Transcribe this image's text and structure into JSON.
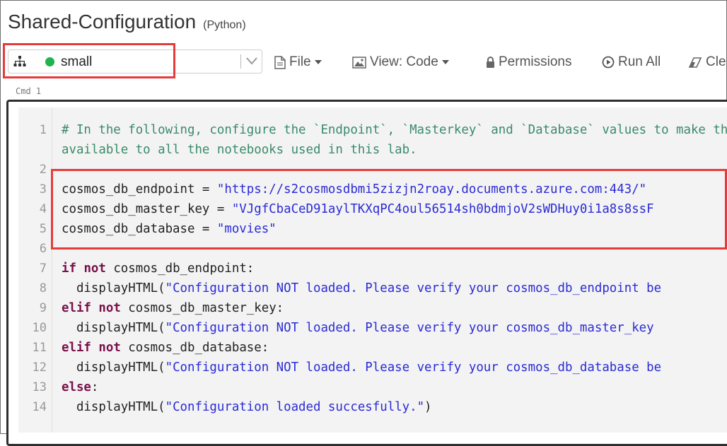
{
  "notebook": {
    "title": "Shared-Configuration",
    "language": "(Python)"
  },
  "toolbar": {
    "cluster_name": "small",
    "cluster_status_color": "#1db34d",
    "file_label": "File",
    "view_label": "View: Code",
    "permissions_label": "Permissions",
    "run_all_label": "Run All",
    "clear_label": "Cle"
  },
  "cell": {
    "cmd_label": "Cmd 1",
    "line_numbers": [
      "1",
      "2",
      "3",
      "4",
      "5",
      "6",
      "7",
      "8",
      "9",
      "10",
      "11",
      "12",
      "13",
      "14"
    ],
    "comment_line1": "# In the following, configure the `Endpoint`, `Masterkey` and `Database` values to make them",
    "comment_line2": "available to all the notebooks used in this lab.",
    "endpoint_var": "cosmos_db_endpoint = ",
    "endpoint_value": "\"https://s2cosmosdbmi5zizjn2roay.documents.azure.com:443/\"",
    "master_key_var": "cosmos_db_master_key = ",
    "master_key_value": "\"VJgfCbaCeD91aylTKXqPC4oul56514sh0bdmjoV2sWDHuy0i1a8s8ssF",
    "database_var": "cosmos_db_database = ",
    "database_value": "\"movies\"",
    "kw_if": "if",
    "kw_not": "not",
    "kw_elif": "elif",
    "kw_else": "else",
    "cond_endpoint": " cosmos_db_endpoint:",
    "cond_master_key": " cosmos_db_master_key:",
    "cond_database": " cosmos_db_database:",
    "else_colon": ":",
    "call_prefix": "  displayHTML(",
    "call_suffix": ")",
    "msg_endpoint": "\"Configuration NOT loaded. Please verify your cosmos_db_endpoint be",
    "msg_master_key": "\"Configuration NOT loaded. Please verify your cosmos_db_master_key",
    "msg_database": "\"Configuration NOT loaded. Please verify your cosmos_db_database be",
    "msg_success": "\"Configuration loaded succesfully.\""
  }
}
